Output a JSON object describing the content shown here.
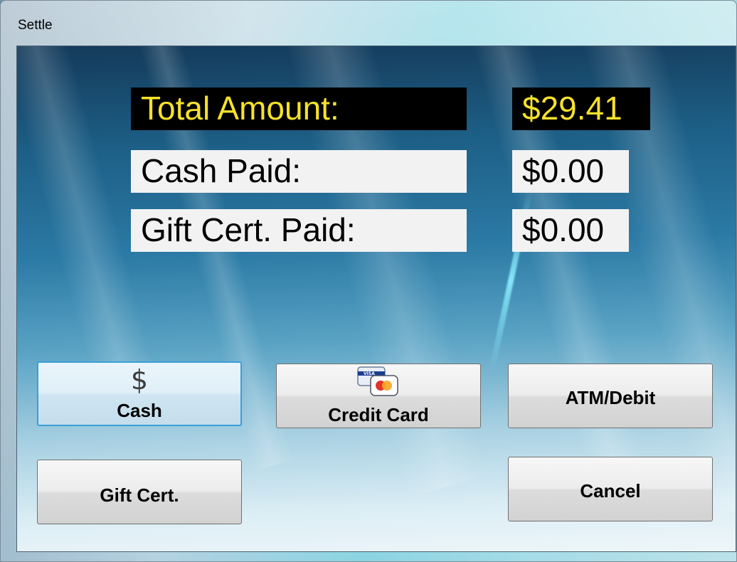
{
  "window": {
    "title": "Settle"
  },
  "summary": {
    "total_label": "Total Amount:",
    "total_value": "$29.41",
    "cash_label": "Cash Paid:",
    "cash_value": "$0.00",
    "gift_label": "Gift Cert. Paid:",
    "gift_value": "$0.00"
  },
  "buttons": {
    "cash": "Cash",
    "credit_card": "Credit Card",
    "atm_debit": "ATM/Debit",
    "gift_cert": "Gift Cert.",
    "cancel": "Cancel"
  },
  "icons": {
    "cash": "dollar-icon",
    "credit_card": "credit-card-icon",
    "card_brand_text": "VISA"
  },
  "colors": {
    "total_bg": "#000000",
    "total_text": "#f5e22a",
    "focus_border": "#3c9fd8"
  }
}
